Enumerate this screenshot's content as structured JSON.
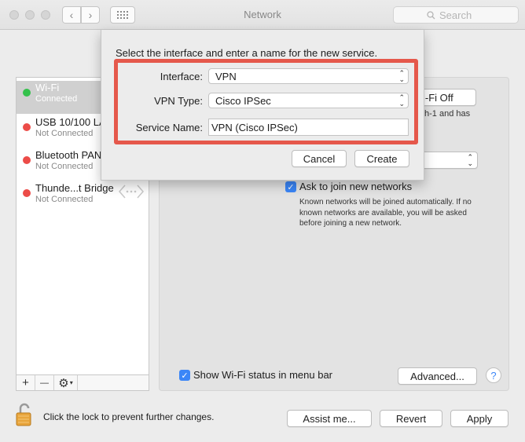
{
  "window": {
    "title": "Network",
    "search_placeholder": "Search"
  },
  "sidebar": {
    "items": [
      {
        "name": "Wi-Fi",
        "status": "Connected",
        "dot": "#34c14b"
      },
      {
        "name": "USB 10/100 LAN",
        "status": "Not Connected",
        "dot": "#ec4c48"
      },
      {
        "name": "Bluetooth PAN",
        "status": "Not Connected",
        "dot": "#ec4c48"
      },
      {
        "name": "Thunde...t Bridge",
        "status": "Not Connected",
        "dot": "#ec4c48"
      }
    ],
    "footer": {
      "add": "+",
      "remove": "—",
      "action": "⚙"
    }
  },
  "panel": {
    "wifi_off_partial": "i-Fi Off",
    "info_partial_1": "h-1 and has",
    "ask_join_label": "Ask to join new networks",
    "ask_join_help": "Known networks will be joined automatically. If no known networks are available, you will be asked before joining a new network.",
    "show_status_label": "Show Wi-Fi status in menu bar",
    "advanced_label": "Advanced...",
    "help_glyph": "?"
  },
  "sheet": {
    "title": "Select the interface and enter a name for the new service.",
    "interface_label": "Interface:",
    "interface_value": "VPN",
    "vpn_type_label": "VPN Type:",
    "vpn_type_value": "Cisco IPSec",
    "service_name_label": "Service Name:",
    "service_name_value": "VPN (Cisco IPSec)",
    "cancel_label": "Cancel",
    "create_label": "Create"
  },
  "bottom": {
    "lock_text": "Click the lock to prevent further changes.",
    "assist_label": "Assist me...",
    "revert_label": "Revert",
    "apply_label": "Apply"
  },
  "colors": {
    "highlight": "#e5584b",
    "accent": "#3b86f7"
  }
}
